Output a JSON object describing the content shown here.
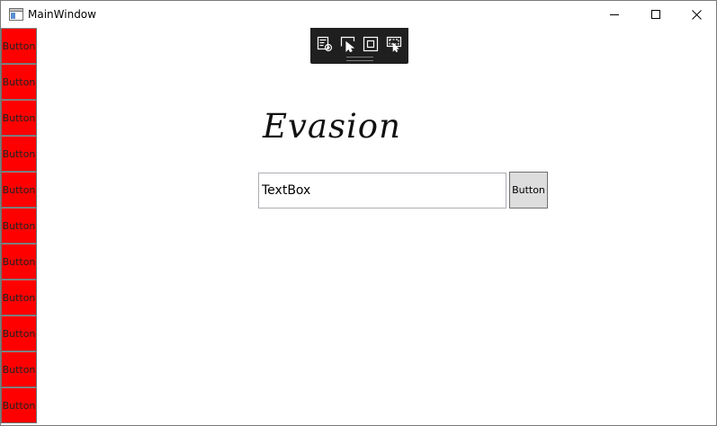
{
  "window": {
    "title": "MainWindow",
    "controls": {
      "minimize": "minimize",
      "maximize": "maximize",
      "close": "close"
    }
  },
  "sidebar": {
    "color": "#ff0000",
    "buttons": [
      {
        "label": "Button"
      },
      {
        "label": "Button"
      },
      {
        "label": "Button"
      },
      {
        "label": "Button"
      },
      {
        "label": "Button"
      },
      {
        "label": "Button"
      },
      {
        "label": "Button"
      },
      {
        "label": "Button"
      },
      {
        "label": "Button"
      },
      {
        "label": "Button"
      },
      {
        "label": "Button"
      }
    ]
  },
  "debug_toolbar": {
    "icons": [
      "live-visual-tree-icon",
      "select-element-icon",
      "display-layout-adorners-icon",
      "track-focused-element-icon"
    ]
  },
  "main": {
    "heading": "Evasion",
    "textbox_value": "TextBox",
    "button_label": "Button"
  }
}
